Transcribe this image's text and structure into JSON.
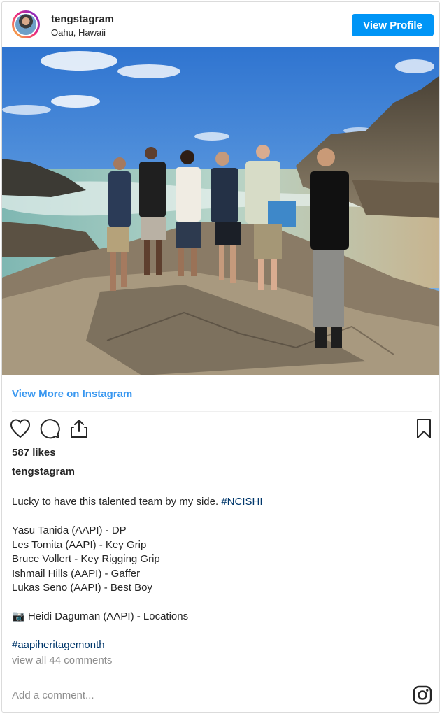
{
  "header": {
    "username": "tengstagram",
    "location": "Oahu, Hawaii",
    "view_profile_label": "View Profile"
  },
  "view_more_label": "View More on Instagram",
  "likes": "587 likes",
  "caption": {
    "username": "tengstagram",
    "lines": [
      {
        "text": "Lucky to have this talented team by my side. ",
        "hashtag": "#NCISHI"
      },
      {
        "text": ""
      },
      {
        "text": "Yasu Tanida (AAPI) - DP"
      },
      {
        "text": "Les Tomita (AAPI) - Key Grip"
      },
      {
        "text": "Bruce Vollert - Key Rigging Grip"
      },
      {
        "text": "Ishmail Hills (AAPI) - Gaffer"
      },
      {
        "text": "Lukas Seno (AAPI) - Best Boy"
      },
      {
        "text": ""
      },
      {
        "text": "📷 Heidi Daguman (AAPI) - Locations"
      },
      {
        "text": ""
      },
      {
        "text": "",
        "hashtag": "#aapiheritagemonth"
      }
    ]
  },
  "view_comments_label": "view all 44 comments",
  "comment_placeholder": "Add a comment...",
  "icons": [
    "heart-icon",
    "comment-icon",
    "share-icon",
    "bookmark-icon",
    "instagram-icon"
  ],
  "colors": {
    "accent": "#0095f6",
    "link": "#3897f0",
    "hashtag": "#00376b",
    "muted": "#8e8e8e"
  }
}
